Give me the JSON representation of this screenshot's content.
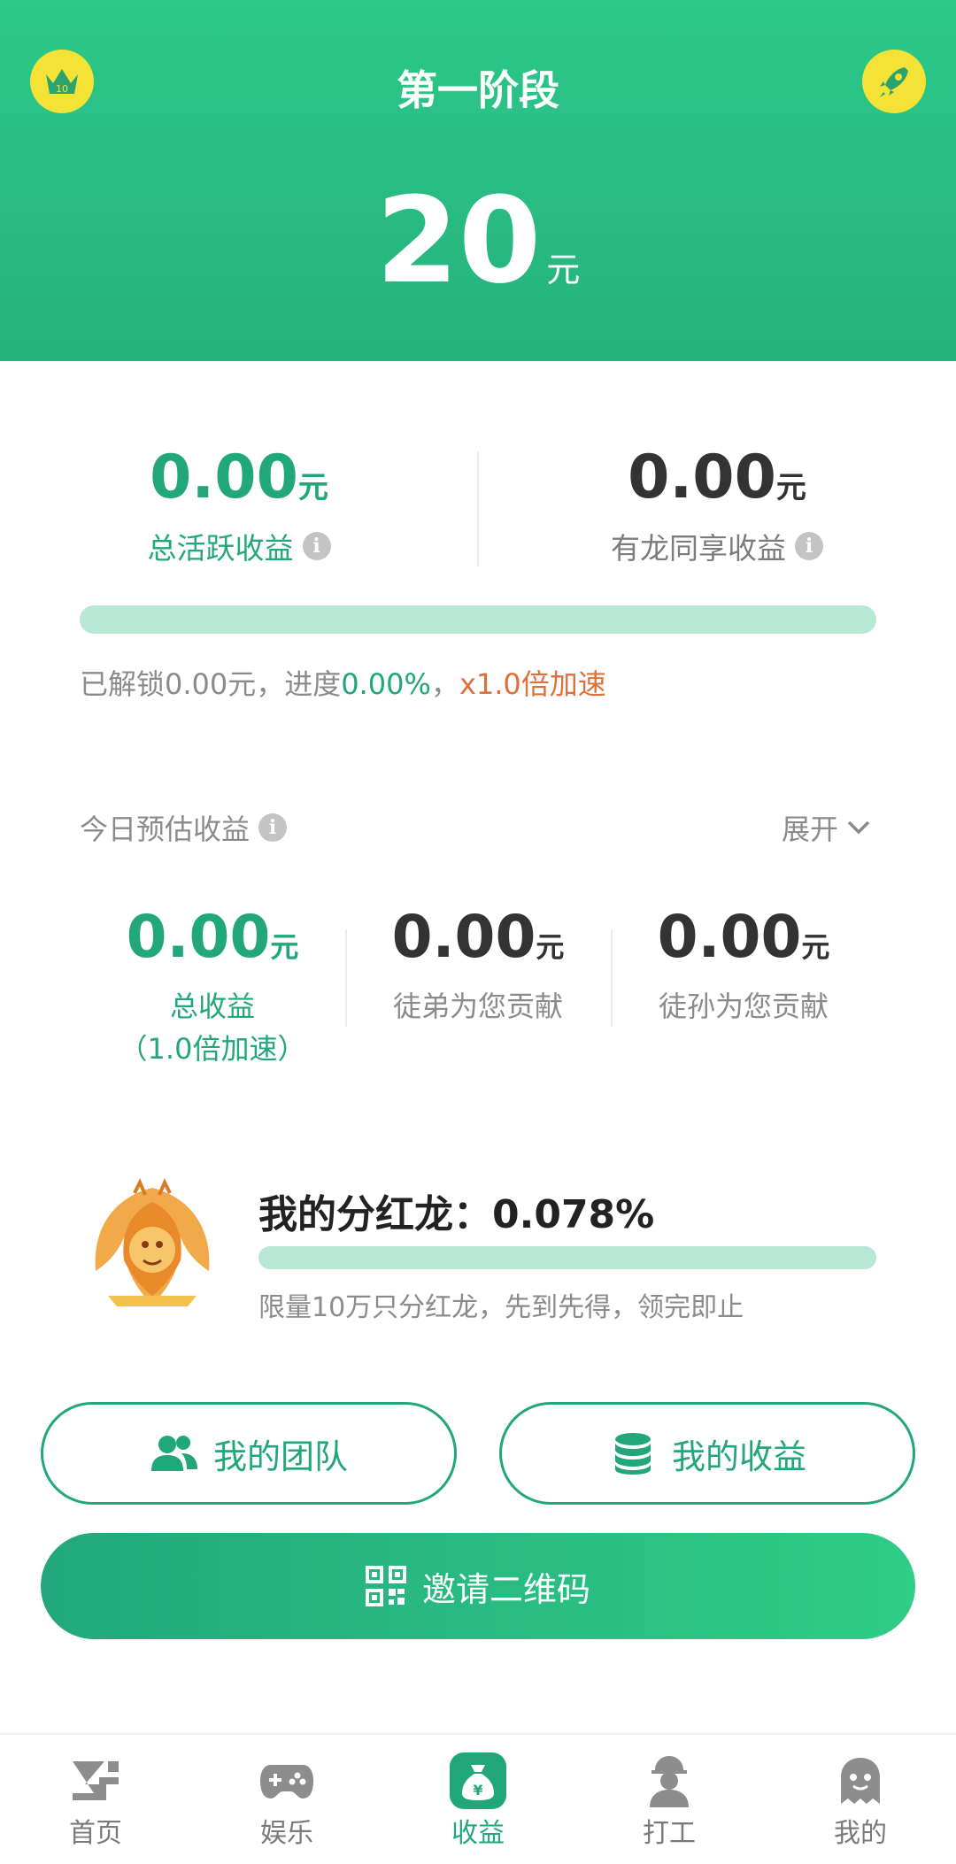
{
  "header": {
    "title": "第一阶段",
    "amount": "20",
    "unit": "元",
    "left_badge_level": "10"
  },
  "active_income": {
    "value": "0.00",
    "unit": "元",
    "label": "总活跃收益"
  },
  "shared_income": {
    "value": "0.00",
    "unit": "元",
    "label": "有龙同享收益"
  },
  "progress": {
    "fraction": 0.0,
    "text_prefix": "已解锁0.00元，进度",
    "percent": "0.00%",
    "sep": "，",
    "speed": "x1.0倍加速"
  },
  "today": {
    "title": "今日预估收益",
    "expand_label": "展开",
    "total": {
      "value": "0.00",
      "unit": "元",
      "label": "总收益",
      "sub": "（1.0倍加速）"
    },
    "disciple": {
      "value": "0.00",
      "unit": "元",
      "label": "徒弟为您贡献"
    },
    "grand": {
      "value": "0.00",
      "unit": "元",
      "label": "徒孙为您贡献"
    }
  },
  "dragon": {
    "title": "我的分红龙：0.078%",
    "fraction": 0.00078,
    "note": "限量10万只分红龙，先到先得，领完即止"
  },
  "buttons": {
    "team": "我的团队",
    "income": "我的收益",
    "invite": "邀请二维码"
  },
  "tabs": [
    {
      "label": "首页",
      "icon": "logo-icon"
    },
    {
      "label": "娱乐",
      "icon": "gamepad-icon"
    },
    {
      "label": "收益",
      "icon": "money-bag-icon",
      "active": true
    },
    {
      "label": "打工",
      "icon": "worker-icon"
    },
    {
      "label": "我的",
      "icon": "ghost-icon"
    }
  ],
  "colors": {
    "primary": "#22a77a",
    "header": "#2cc98a",
    "accent": "#e0703a",
    "badge": "#f4e236"
  }
}
